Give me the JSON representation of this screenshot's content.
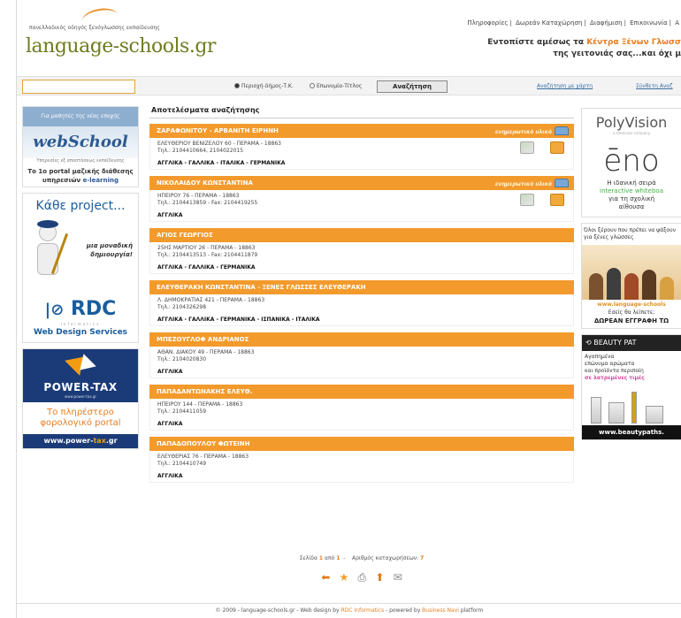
{
  "header": {
    "tagline": "πανελλαδικός οδηγός ξενόγλωσσης εκπαίδευσης",
    "logo": "language-schools.gr",
    "top_links": [
      "Πληροφορίες",
      "Δωρεάν Καταχώρηση",
      "Διαφήμιση",
      "Επικοινωνία",
      "Α"
    ],
    "promo_line1_prefix": "Εντοπίστε αμέσως τα ",
    "promo_line1_highlight": "Κέντρα Ξένων Γλωσσ",
    "promo_line2": "της γειτονιάς σας...και όχι μ"
  },
  "search": {
    "input_value": "",
    "radio_area": "Περιοχή-δήμος-Τ.Κ.",
    "radio_name": "Επωνυμία-Τίτλος",
    "button": "Αναζήτηση",
    "link_map": "Αναζήτηση με χάρτη",
    "link_adv": "Σύνθετη Αναζ"
  },
  "left_banners": {
    "webschool_top": "Για μαθητές της νέας εποχής",
    "webschool_logo": "webSchool",
    "webschool_sub": "Υπηρεσίες εξ αποστάσεως εκπαίδευσης",
    "webschool_txt1": "Το 1ο portal μαζικής διάθεσης",
    "webschool_txt2": "υπηρεσιών",
    "webschool_txt3": "e-learning",
    "project_title": "Κάθε project...",
    "project_msg1": "μια μοναδική",
    "project_msg2": "δημιουργία!",
    "rdc_logo": "RDC",
    "rdc_sub": "informatics",
    "rdc_txt": "Web Design Services",
    "powertax_name": "POWER-TAX",
    "powertax_url": "www.power-tax.gr",
    "powertax_txt1": "Το πληρέστερο",
    "powertax_txt2": "φορολογικό portal",
    "powertax_bottom_a": "www.power-",
    "powertax_bottom_b": "tax",
    "powertax_bottom_c": ".gr"
  },
  "results": {
    "title": "Αποτελέσματα αναζήτησης",
    "badge": "ενημερωτικό υλικό",
    "items": [
      {
        "name": "ΖΑΡΑΦΩΝΙΤΟΥ - ΑΡΒΑΝΙΤΗ ΕΙΡΗΝΗ",
        "addr": "ΕΛΕΥΘΕΡΙΟΥ ΒΕΝΙΖΕΛΟΥ 60 - ΠΕΡΑΜΑ - 18863",
        "tel": "Τηλ.: 2104410664, 2104022015",
        "langs": "ΑΓΓΛΙΚΑ - ΓΑΛΛΙΚΑ - ΙΤΑΛΙΚΑ - ΓΕΡΜΑΝΙΚΑ",
        "badge": true
      },
      {
        "name": "ΝΙΚΟΛΑΙΔΟΥ ΚΩΝΣΤΑΝΤΙΝΑ",
        "addr": "ΗΠΕΙΡΟΥ 76 - ΠΕΡΑΜΑ - 18863",
        "tel": "Τηλ.: 2104413859 - Fax: 2104419255",
        "langs": "ΑΓΓΛΙΚΑ",
        "badge": true
      },
      {
        "name": "ΑΓΙΟΣ ΓΕΩΡΓΙΟΣ",
        "addr": "25ΗΣ ΜΑΡΤΙΟΥ 26 - ΠΕΡΑΜΑ - 18863",
        "tel": "Τηλ.: 2104413513 - Fax: 2104411879",
        "langs": "ΑΓΓΛΙΚΑ - ΓΑΛΛΙΚΑ - ΓΕΡΜΑΝΙΚΑ",
        "badge": false
      },
      {
        "name": "ΕΛΕΥΘΕΡΑΚΗ ΚΩΝΣΤΑΝΤΙΝΑ - ΞΕΝΕΣ ΓΛΩΣΣΕΣ ΕΛΕΥΘΕΡΑΚΗ",
        "addr": "Λ. ΔΗΜΟΚΡΑΤΙΑΣ 421 - ΠΕΡΑΜΑ - 18863",
        "tel": "Τηλ.: 2104326298",
        "langs": "ΑΓΓΛΙΚΑ - ΓΑΛΛΙΚΑ - ΓΕΡΜΑΝΙΚΑ - ΙΣΠΑΝΙΚΑ - ΙΤΑΛΙΚΑ",
        "badge": false
      },
      {
        "name": "ΜΠΕΖΟΥΓΛΟΦ ΑΝΔΡΙΑΝΟΣ",
        "addr": "ΑΘΑΝ. ΔΙΑΚΟΥ 49 - ΠΕΡΑΜΑ - 18863",
        "tel": "Τηλ.: 2104020830",
        "langs": "ΑΓΓΛΙΚΑ",
        "badge": false
      },
      {
        "name": "ΠΑΠΑΔΑΝΤΩΝΑΚΗΣ ΕΛΕΥΘ.",
        "addr": "ΗΠΕΙΡΟΥ 144 - ΠΕΡΑΜΑ - 18863",
        "tel": "Τηλ.: 2104411059",
        "langs": "ΑΓΓΛΙΚΑ",
        "badge": false
      },
      {
        "name": "ΠΑΠΑΔΟΠΟΥΛΟΥ ΦΩΤΕΙΝΗ",
        "addr": "ΕΛΕΥΘΕΡΙΑΣ 76 - ΠΕΡΑΜΑ - 18863",
        "tel": "Τηλ.: 2104410749",
        "langs": "ΑΓΓΛΙΚΑ",
        "badge": false
      }
    ]
  },
  "pager": {
    "page_label": "Σελίδα",
    "page": "1",
    "of_label": "από",
    "total_pages": "1",
    "count_label": "Αριθμός καταχωρήσεων:",
    "count": "7"
  },
  "footer": {
    "prefix": "© 2009 - language-schools.gr - Web design by ",
    "rdc": "RDC Informatics",
    "middle": " - powered by ",
    "bn": "Business Navi",
    "suffix": " platform"
  },
  "right_banners": {
    "pv_title": "PolyVision",
    "pv_sub": "a steelcase company",
    "pv_eno": "ēno",
    "pv_t1": "Η ιδανική σειρά",
    "pv_t2": "interactive whiteboa",
    "pv_t3a": "για τη σχολική",
    "pv_t3b": "αίθουσα",
    "ls_text": "Όλοι ξέρουν που πρέπει να ψάξουν για ξένες γλώσσες",
    "ls_url": "www.language-schools",
    "ls_q": "Εσείς θα λείπετε;",
    "ls_free": "ΔΩΡΕΑΝ ΕΓΓΡΑΦΗ ΤΩ",
    "bp_title": "BEAUTY PAT",
    "bp_t1": "Αγαπημένα",
    "bp_t2": "επώνυμα αρώματα",
    "bp_t3": "και προϊόντα περιποίη",
    "bp_t4": "σε λατρεμένες τιμές",
    "bp_url": "www.beautypaths."
  },
  "colors": {
    "accent_orange": "#f39a2c",
    "logo_green": "#6f7b1f",
    "link_blue": "#3a6ea5"
  }
}
